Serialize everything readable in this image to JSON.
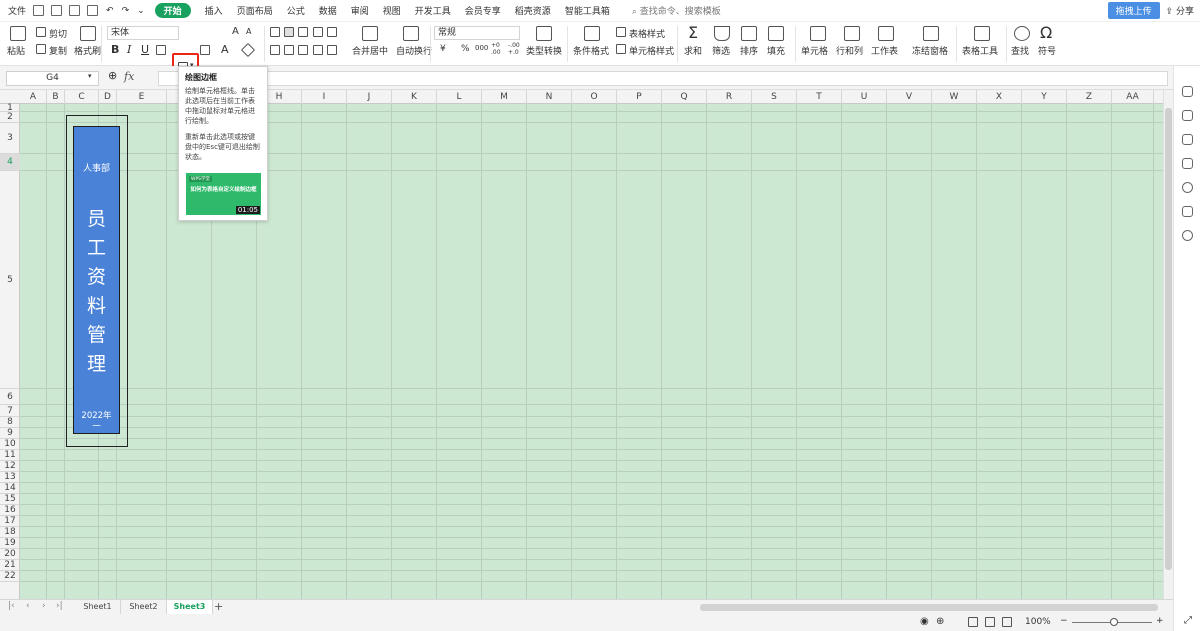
{
  "menubar": {
    "file": "文件",
    "tabs": [
      "开始",
      "插入",
      "页面布局",
      "公式",
      "数据",
      "审阅",
      "视图",
      "开发工具",
      "会员专享",
      "稻壳资源",
      "智能工具箱"
    ],
    "search_placeholder": "查找命令、搜索模板",
    "cloud_upload": "拖拽上传",
    "share": "分享"
  },
  "ribbon": {
    "paste": "粘贴",
    "cut": "剪切",
    "copy": "复制",
    "format_painter": "格式刷",
    "font_name": "宋体",
    "bold": "B",
    "italic": "I",
    "underline": "U",
    "font_grow": "A",
    "font_shrink": "A",
    "merge_center": "合并居中",
    "wrap_text": "自动换行",
    "number_format": "常规",
    "currency": "¥",
    "percent": "%",
    "thousands": "000",
    "dec_increase": "+0 .00",
    "dec_decrease": "-.00 +.0",
    "type_convert": "类型转换",
    "conditional_format": "条件格式",
    "table_style": "表格样式",
    "cell_style": "单元格样式",
    "sum": "求和",
    "filter": "筛选",
    "sort": "排序",
    "fill": "填充",
    "cells": "单元格",
    "rows_cols": "行和列",
    "worksheet": "工作表",
    "freeze": "冻结窗格",
    "table_tools": "表格工具",
    "find": "查找",
    "symbol": "符号"
  },
  "formulabar": {
    "namebox": "G4",
    "fx": "fx",
    "formula": ""
  },
  "columns": [
    "A",
    "B",
    "C",
    "D",
    "E",
    "F",
    "G",
    "H",
    "I",
    "J",
    "K",
    "L",
    "M",
    "N",
    "O",
    "P",
    "Q",
    "R",
    "S",
    "T",
    "U",
    "V",
    "W",
    "X",
    "Y",
    "Z",
    "AA"
  ],
  "rows": [
    "1",
    "2",
    "3",
    "4",
    "5",
    "6",
    "7",
    "8",
    "9",
    "10",
    "11",
    "12",
    "13",
    "14",
    "15",
    "16",
    "17",
    "18",
    "19",
    "20",
    "21",
    "22"
  ],
  "selected_row": "4",
  "card": {
    "department": "人事部",
    "title_chars": [
      "员",
      "工",
      "资",
      "料",
      "管",
      "理"
    ],
    "year": "2022年",
    "dash": "一",
    "fill_color": "#4a82d8"
  },
  "tooltip": {
    "title": "绘图边框",
    "desc1": "绘制单元格框线。单击此选项后在当前工作表中拖动鼠标对单元格进行绘制。",
    "desc2": "重新单击此选项或按键盘中的Esc键可退出绘制状态。",
    "video_caption": "如何为表格自定义绘制边框",
    "video_time": "01:05",
    "video_logo": "WPS学堂"
  },
  "sheets": [
    "Sheet1",
    "Sheet2",
    "Sheet3"
  ],
  "active_sheet": "Sheet3",
  "statusbar": {
    "zoom": "100%"
  },
  "colors": {
    "accent": "#19a15f",
    "grid_bg": "#cde8d2",
    "highlight": "#e8261a"
  }
}
